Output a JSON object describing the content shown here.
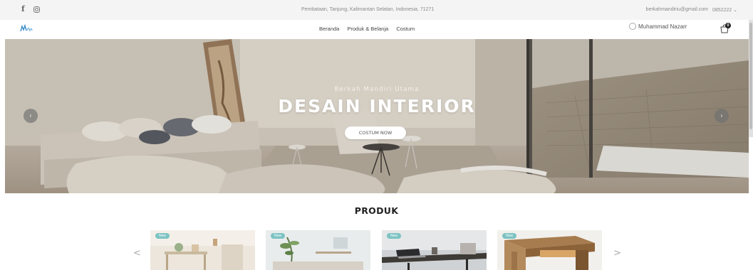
{
  "topbar": {
    "address": "Pembataan, Tanjung, Kalimantan Selatan, Indonesia, 71271",
    "email": "berkahmandiriu@gmail.com",
    "phone": "0852222 ⌄",
    "social_icons": [
      "facebook-icon",
      "instagram-icon"
    ]
  },
  "nav": {
    "links": [
      "Beranda",
      "Produk & Belanja",
      "Costum"
    ],
    "user_name": "Muhammad Nazarr",
    "cart_count": "0"
  },
  "hero": {
    "subtitle": "Berkah Mandiri Utama",
    "title": "DESAIN INTERIOR",
    "button_label": "COSTUM NOW",
    "prev_arrow": "‹",
    "next_arrow": "›"
  },
  "products": {
    "title": "PRODUK",
    "prev": "<",
    "next": ">",
    "items": [
      {
        "badge": "New"
      },
      {
        "badge": "New"
      },
      {
        "badge": "New"
      },
      {
        "badge": "New"
      }
    ]
  },
  "colors": {
    "badge": "#7cc3c2",
    "topbar_bg": "#f4f4f4"
  }
}
